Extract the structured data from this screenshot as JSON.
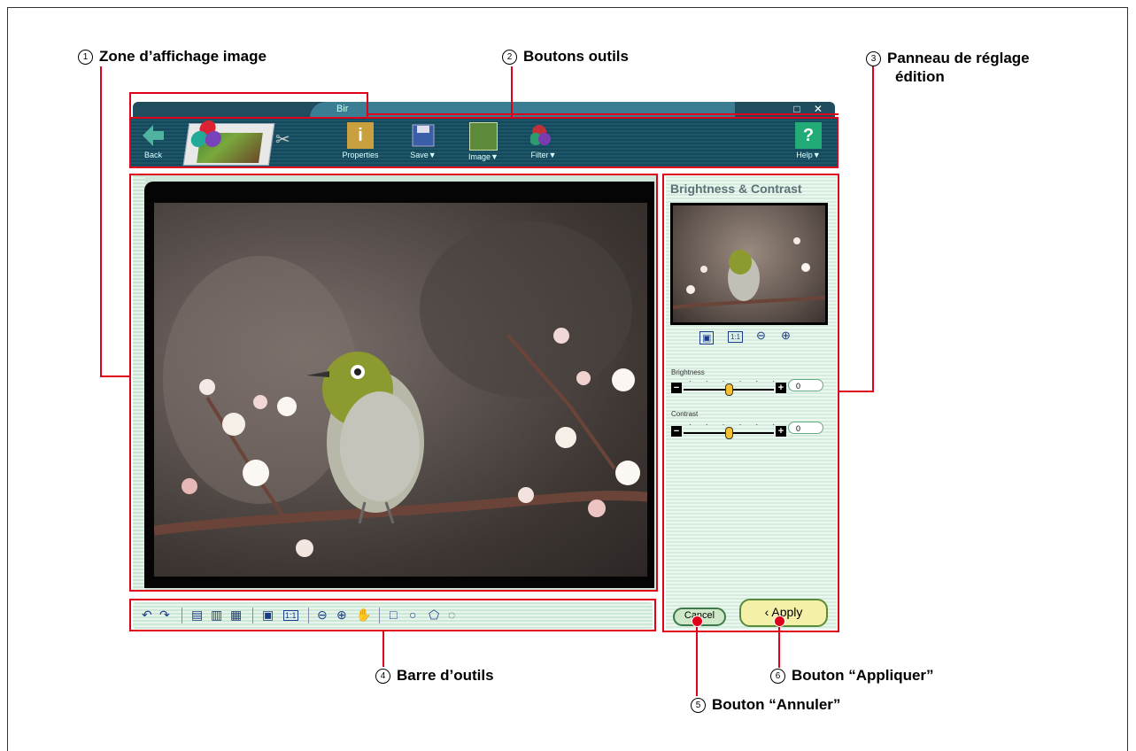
{
  "callouts": {
    "c1": {
      "num": "1",
      "label": "Zone d’affichage image"
    },
    "c2": {
      "num": "2",
      "label": "Boutons outils"
    },
    "c3": {
      "num": "3",
      "label": "Panneau de réglage",
      "label2": "édition"
    },
    "c4": {
      "num": "4",
      "label": "Barre d’outils"
    },
    "c5": {
      "num": "5",
      "label": "Bouton “Annuler”"
    },
    "c6": {
      "num": "6",
      "label": "Bouton “Appliquer”"
    }
  },
  "window": {
    "title": "Bir",
    "controls": "_ □ ✕"
  },
  "toolbar": {
    "back_label": "Back",
    "properties_label": "Properties",
    "save_label": "Save▼",
    "image_label": "Image▼",
    "filter_label": "Filter▼",
    "help_label": "Help▼"
  },
  "panel": {
    "title": "Brightness & Contrast",
    "brightness_label": "Brightness",
    "brightness_value": "0",
    "contrast_label": "Contrast",
    "contrast_value": "0",
    "cancel_label": "Cancel",
    "apply_label": "Apply"
  },
  "icons": [
    "undo-icon",
    "redo-icon",
    "copy-icon",
    "copy-pages-icon",
    "paste-icon",
    "fit-icon",
    "actual-size-icon",
    "zoom-out-icon",
    "zoom-in-icon",
    "hand-icon",
    "rect-select-icon",
    "ellipse-select-icon",
    "polygon-select-icon",
    "lasso-select-icon"
  ],
  "colors": {
    "callout_red": "#e0001a",
    "toolbar_bg": "#15485a",
    "panel_bg": "#d4ecdd"
  }
}
